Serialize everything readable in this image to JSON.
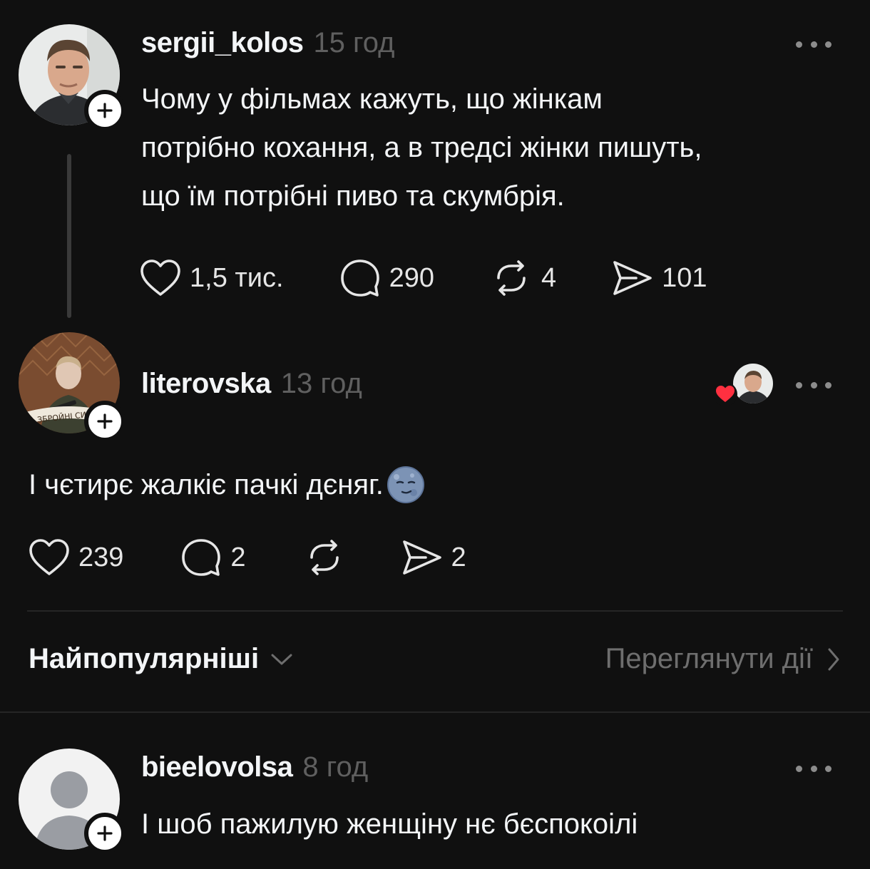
{
  "post": {
    "username": "sergii_kolos",
    "time": "15 год",
    "text_lines": [
      "Чому у фільмах кажуть, що жінкам",
      "потрібно кохання, а в тредсі жінки пишуть,",
      "що їм потрібні пиво та скумбрія."
    ],
    "likes": "1,5 тис.",
    "comments": "290",
    "reposts": "4",
    "shares": "101"
  },
  "reply": {
    "username": "literovska",
    "time": "13 год",
    "text": "І чєтирє жалкіє пачкі дєняг.",
    "avatar_banner_text": "ЗБРОЙНІ СИЛИ У",
    "likes": "239",
    "comments": "2",
    "reposts": "",
    "shares": "2"
  },
  "sort": {
    "label": "Найпопулярніші",
    "view_activity": "Переглянути дії"
  },
  "comment": {
    "username": "bieelovolsa",
    "time": "8 год",
    "text": "І шоб пажилую женщіну нє бєспокоілі"
  },
  "colors": {
    "background": "#101010",
    "text": "#f3f5f7",
    "muted": "#5f5f5f",
    "heart_red": "#ff3040"
  },
  "icons": [
    "heart-icon",
    "comment-icon",
    "repost-icon",
    "share-icon",
    "plus-icon",
    "more-icon",
    "chevron-down-icon",
    "chevron-right-icon",
    "moon-face-emoji"
  ]
}
